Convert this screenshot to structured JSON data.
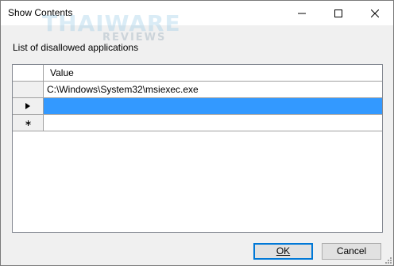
{
  "window": {
    "title": "Show Contents"
  },
  "watermark": {
    "main": "THAIWARE",
    "sub": "REVIEWS"
  },
  "content": {
    "list_label": "List of disallowed applications"
  },
  "grid": {
    "column_header": "Value",
    "rows": [
      {
        "value": "C:\\Windows\\System32\\msiexec.exe",
        "marker": ""
      },
      {
        "value": "",
        "marker": "current-row-arrow",
        "selected": true
      },
      {
        "value": "",
        "marker": "new-row-asterisk"
      }
    ],
    "selection_color": "#3399ff"
  },
  "buttons": {
    "ok": "OK",
    "cancel": "Cancel"
  },
  "colors": {
    "accent": "#0078d7"
  }
}
